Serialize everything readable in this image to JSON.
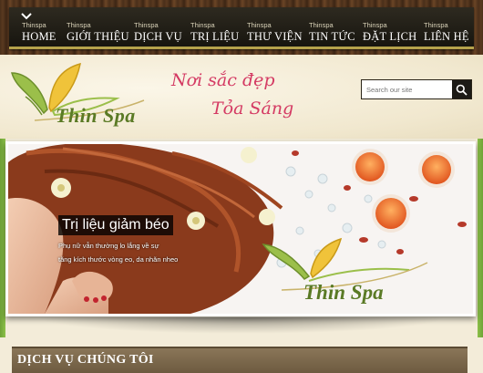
{
  "nav": {
    "items": [
      {
        "sub": "Thinspa",
        "label": "HOME"
      },
      {
        "sub": "Thinspa",
        "label": "GIỚI THIỆU"
      },
      {
        "sub": "Thinspa",
        "label": "DỊCH VỤ"
      },
      {
        "sub": "Thinspa",
        "label": "TRỊ LIỆU"
      },
      {
        "sub": "Thinspa",
        "label": "THƯ VIỆN"
      },
      {
        "sub": "Thinspa",
        "label": "TIN TỨC"
      },
      {
        "sub": "Thinspa",
        "label": "ĐẶT LỊCH"
      },
      {
        "sub": "Thinspa",
        "label": "LIÊN HỆ"
      }
    ],
    "toggle_icon": "chevron-down-icon"
  },
  "header": {
    "logo_text": "Thin Spa",
    "slogan_line1": "Nơi sắc đẹp",
    "slogan_line2": "Tỏa Sáng"
  },
  "search": {
    "placeholder": "Search our site",
    "icon": "search-icon"
  },
  "banner": {
    "title": "Trị liệu giảm béo",
    "desc_line1": "Phụ nữ vẫn thường lo lắng về sự",
    "desc_line2": "tăng kích thước vòng eo, da nhăn nheo",
    "logo_text": "Thin Spa"
  },
  "section": {
    "title": "DỊCH VỤ CHÚNG TÔI"
  },
  "colors": {
    "accent_pink": "#d43a63",
    "logo_green": "#5a7a25",
    "nav_underline": "#b5a24b",
    "section_brown": "#7a6748"
  }
}
